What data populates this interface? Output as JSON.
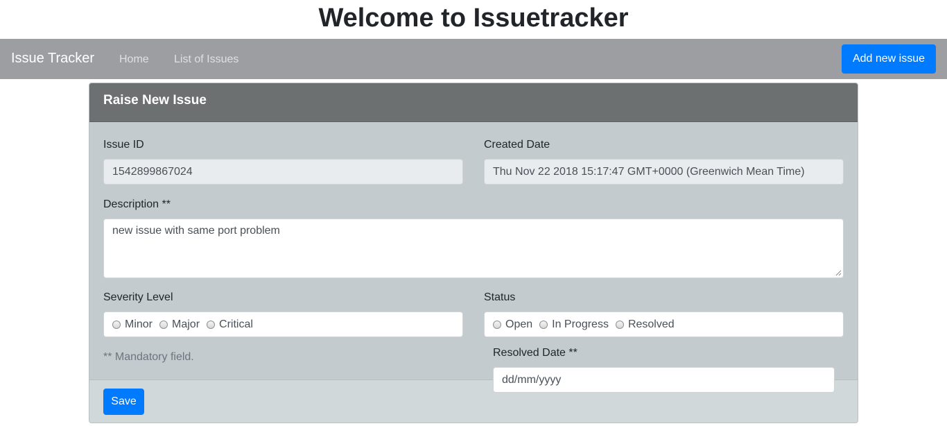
{
  "page": {
    "title": "Welcome to Issuetracker"
  },
  "navbar": {
    "brand": "Issue Tracker",
    "links": [
      "Home",
      "List of Issues"
    ],
    "add_button": "Add new issue"
  },
  "form": {
    "header": "Raise New Issue",
    "issue_id": {
      "label": "Issue ID",
      "value": "1542899867024"
    },
    "created_date": {
      "label": "Created Date",
      "value": "Thu Nov 22 2018 15:17:47 GMT+0000 (Greenwich Mean Time)"
    },
    "description": {
      "label": "Description **",
      "value": "new issue with same port problem"
    },
    "severity": {
      "label": "Severity Level",
      "options": [
        "Minor",
        "Major",
        "Critical"
      ]
    },
    "status": {
      "label": "Status",
      "options": [
        "Open",
        "In Progress",
        "Resolved"
      ]
    },
    "resolved_date": {
      "label": "Resolved Date **",
      "placeholder": "dd/mm/yyyy"
    },
    "mandatory_note": "** Mandatory field.",
    "save_label": "Save"
  },
  "colors": {
    "primary": "#007bff",
    "navbar_bg": "#9c9ea1",
    "card_header_bg": "#6c7071",
    "card_body_bg": "#c3cbce"
  }
}
